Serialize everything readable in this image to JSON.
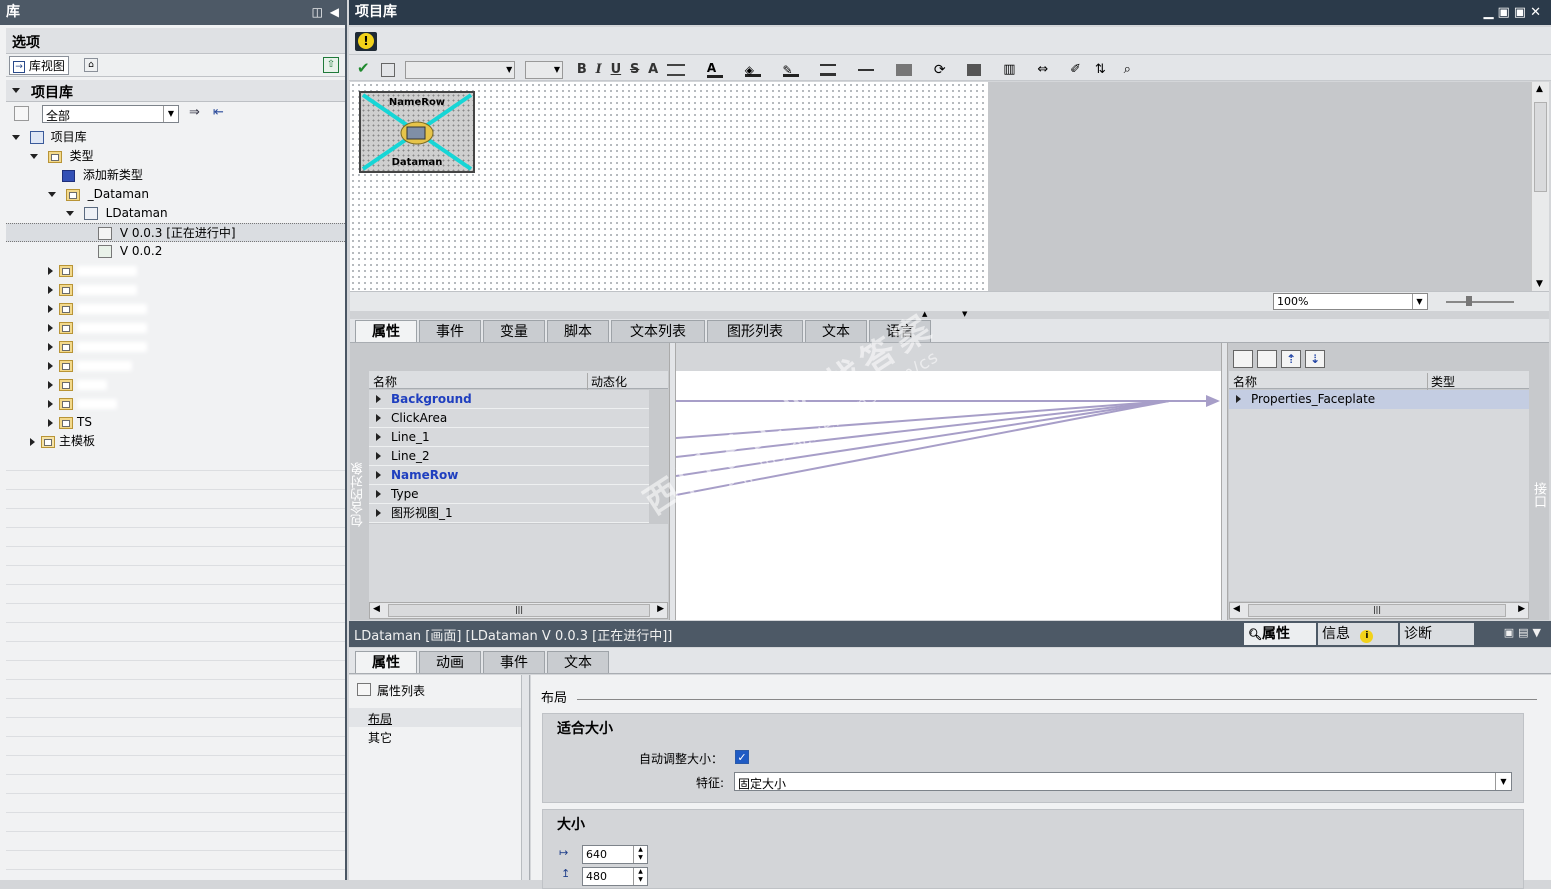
{
  "library_panel": {
    "title": "库",
    "options_label": "选项",
    "library_view_label": "库视图",
    "project_library_label": "项目库",
    "filter_value": "全部",
    "tree": {
      "root": "项目库",
      "types": "类型",
      "add_new_type": "添加新类型",
      "dataman_folder": "_Dataman",
      "ldataman": "LDataman",
      "version_current": "V 0.0.3 [正在进行中]",
      "version_prev": "V 0.0.2",
      "ts": "TS",
      "master_template": "主模板"
    }
  },
  "editor": {
    "title": "项目库",
    "zoom_value": "100%",
    "faceplate_top_label": "NameRow",
    "faceplate_bottom_label": "Dataman",
    "toolbar": {
      "bold": "B",
      "italic": "I",
      "underline": "U",
      "strike": "S",
      "font_size": "A"
    }
  },
  "interface_tabs": [
    "属性",
    "事件",
    "变量",
    "脚本",
    "文本列表",
    "图形列表",
    "文本",
    "语言"
  ],
  "contained_objects": {
    "side_label": "包含的对象",
    "col_name": "名称",
    "col_dynamic": "动态化",
    "rows": [
      {
        "name": "Background",
        "highlight": true
      },
      {
        "name": "ClickArea",
        "highlight": false
      },
      {
        "name": "Line_1",
        "highlight": false
      },
      {
        "name": "Line_2",
        "highlight": false
      },
      {
        "name": "NameRow",
        "highlight": true
      },
      {
        "name": "Type",
        "highlight": false
      },
      {
        "name": "图形视图_1",
        "highlight": false
      }
    ]
  },
  "interface": {
    "side_label": "接口",
    "col_name": "名称",
    "col_type": "类型",
    "rows": [
      {
        "name": "Properties_Faceplate"
      }
    ]
  },
  "inspector": {
    "title": "LDataman [画面] [LDataman V 0.0.3 [正在进行中]]",
    "right_tabs": [
      "属性",
      "信息",
      "诊断"
    ],
    "tabs": [
      "属性",
      "动画",
      "事件",
      "文本"
    ],
    "property_list_label": "属性列表",
    "nav_items": [
      "布局",
      "其它"
    ],
    "section_heading": "布局",
    "fit_size_heading": "适合大小",
    "auto_resize_label": "自动调整大小：",
    "auto_resize_checked": true,
    "feature_label": "特征:",
    "feature_value": "固定大小",
    "size_heading": "大小",
    "width_value": "640",
    "height_value": "480"
  },
  "watermark": {
    "line1": "西门子工业 找答案",
    "line2": "support.industry.siemens.com/cs"
  }
}
